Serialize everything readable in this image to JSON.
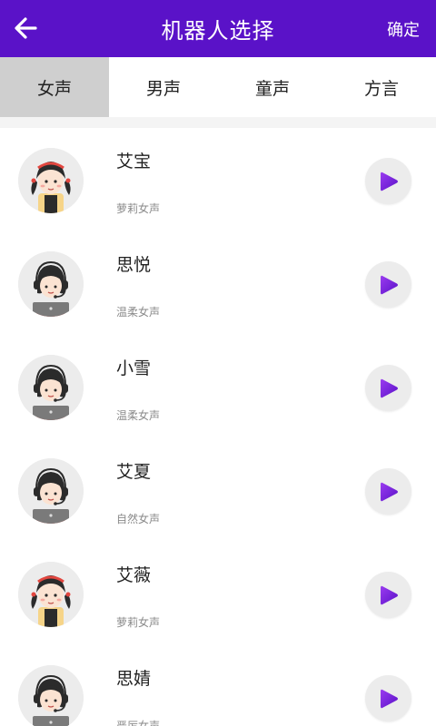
{
  "header": {
    "title": "机器人选择",
    "confirm_label": "确定",
    "back_icon": "arrow-left-icon",
    "background": "#5a12c8"
  },
  "tabs": [
    {
      "label": "女声",
      "active": true
    },
    {
      "label": "男声",
      "active": false
    },
    {
      "label": "童声",
      "active": false
    },
    {
      "label": "方言",
      "active": false
    }
  ],
  "voices": [
    {
      "name": "艾宝",
      "desc": "萝莉女声",
      "avatar": "girl-pigtails-avatar"
    },
    {
      "name": "思悦",
      "desc": "温柔女声",
      "avatar": "girl-headset-avatar"
    },
    {
      "name": "小雪",
      "desc": "温柔女声",
      "avatar": "girl-headset-avatar"
    },
    {
      "name": "艾夏",
      "desc": "自然女声",
      "avatar": "girl-headset-avatar"
    },
    {
      "name": "艾薇",
      "desc": "萝莉女声",
      "avatar": "girl-pigtails-avatar"
    },
    {
      "name": "思婧",
      "desc": "严厉女声",
      "avatar": "girl-headset-avatar"
    }
  ],
  "colors": {
    "accent": "#5a12c8",
    "play_icon": "#7b2de0",
    "active_tab": "#cfcfcf"
  }
}
